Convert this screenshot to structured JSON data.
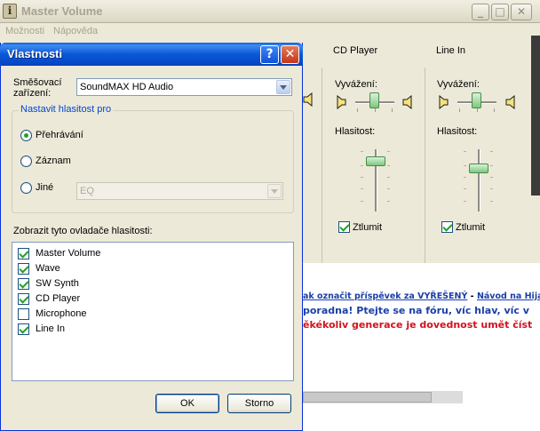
{
  "background_window": {
    "title": "Master Volume",
    "menu": [
      "Možnosti",
      "Nápověda"
    ],
    "channels": [
      {
        "name": "CD Player",
        "balance_label": "Vyvážení:",
        "volume_label": "Hlasitost:",
        "mute_label": "Ztlumit",
        "muted": true
      },
      {
        "name": "Line In",
        "balance_label": "Vyvážení:",
        "volume_label": "Hlasitost:",
        "mute_label": "Ztlumit",
        "muted": true
      }
    ]
  },
  "forum": {
    "link1": "ak označit příspěvek za VYŘEŠENÝ",
    "separator": "-",
    "link2": "Návod na HijackT",
    "line2": "poradna! Ptejte se na fóru, víc hlav, víc v",
    "line3": "ěkékoliv generace je dovednost umět číst"
  },
  "dialog": {
    "title": "Vlastnosti",
    "help_glyph": "?",
    "close_glyph": "✕",
    "mixer_label": "Směšovací zařízení:",
    "mixer_label_line1": "Směšovací",
    "mixer_label_line2": "zařízení:",
    "mixer_value": "SoundMAX HD Audio",
    "adjust_group": "Nastavit hlasitost pro",
    "radio_playback": "Přehrávání",
    "radio_record": "Záznam",
    "radio_other": "Jiné",
    "other_select_value": "EQ",
    "selected_radio": "playback",
    "show_controls_label": "Zobrazit tyto ovladače hlasitosti:",
    "controls": [
      {
        "label": "Master Volume",
        "checked": true
      },
      {
        "label": "Wave",
        "checked": true
      },
      {
        "label": "SW Synth",
        "checked": true
      },
      {
        "label": "CD Player",
        "checked": true
      },
      {
        "label": "Microphone",
        "checked": false
      },
      {
        "label": "Line In",
        "checked": true
      }
    ],
    "ok_label": "OK",
    "cancel_label": "Storno"
  },
  "colors": {
    "title_blue": "#0b58d6",
    "group_legend": "#0046d5",
    "forum_link": "#1a3fa8",
    "forum_red": "#d4121c",
    "check_green": "#21a121"
  }
}
